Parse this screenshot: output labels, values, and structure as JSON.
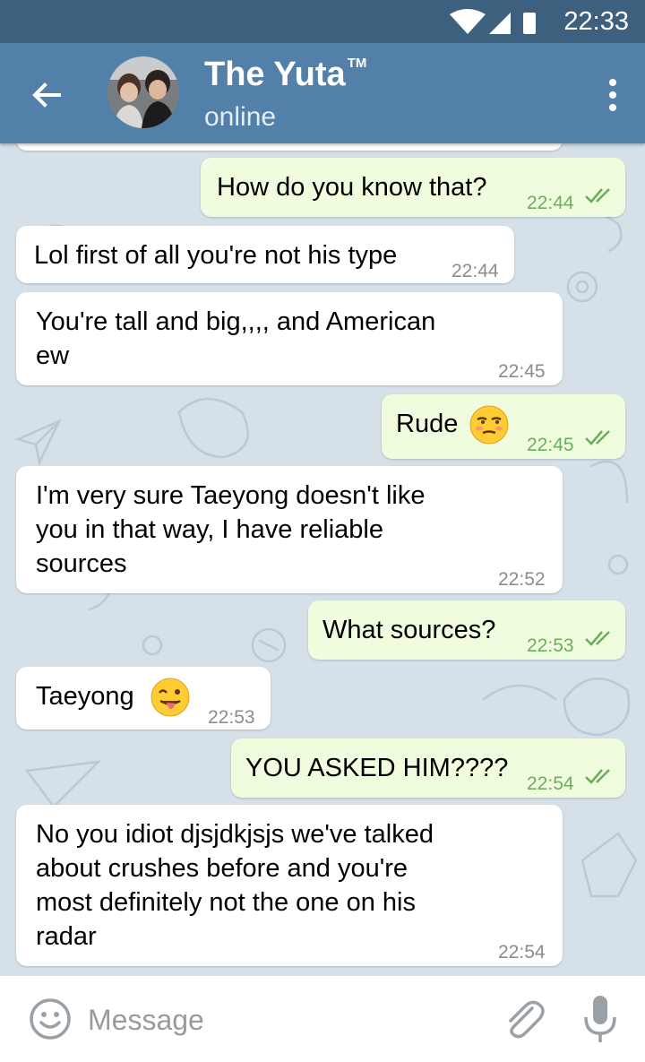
{
  "status_bar": {
    "time": "22:33"
  },
  "chat": {
    "title": "The Yuta",
    "trademark": "TM",
    "status": "online"
  },
  "messages": [
    {
      "direction": "outgoing",
      "text": "How do you know that?",
      "time": "22:44",
      "read": true
    },
    {
      "direction": "incoming",
      "text": "Lol first of all you're not his type",
      "time": "22:44"
    },
    {
      "direction": "incoming",
      "lines": [
        "You're tall and big,,,, and American",
        "ew"
      ],
      "time": "22:45"
    },
    {
      "direction": "outgoing",
      "text": "Rude",
      "emoji": "unamused-face",
      "time": "22:45",
      "read": true
    },
    {
      "direction": "incoming",
      "lines": [
        "I'm very sure Taeyong doesn't like",
        "you in that way, I have reliable",
        "sources"
      ],
      "time": "22:52"
    },
    {
      "direction": "outgoing",
      "text": "What sources?",
      "time": "22:53",
      "read": true
    },
    {
      "direction": "incoming",
      "text": "Taeyong",
      "emoji": "tongue-out-face",
      "time": "22:53"
    },
    {
      "direction": "outgoing",
      "text": "YOU ASKED HIM????",
      "time": "22:54",
      "read": true
    },
    {
      "direction": "incoming",
      "lines": [
        "No you idiot djsjdkjsjs we've talked",
        "about crushes before and you're",
        "most definitely not the one on his",
        "radar"
      ],
      "time": "22:54"
    }
  ],
  "input": {
    "placeholder": "Message"
  },
  "icons": {
    "back": "arrow-left-icon",
    "menu": "more-vertical-icon",
    "emoji": "smiley-icon",
    "attach": "paperclip-icon",
    "mic": "microphone-icon",
    "read": "double-check-icon"
  },
  "colors": {
    "status_bar": "#3e607f",
    "app_bar": "#5280a8",
    "chat_background": "#d5e0e8",
    "incoming_bubble": "#ffffff",
    "outgoing_bubble": "#effdde",
    "outgoing_time": "#6cae5a"
  }
}
